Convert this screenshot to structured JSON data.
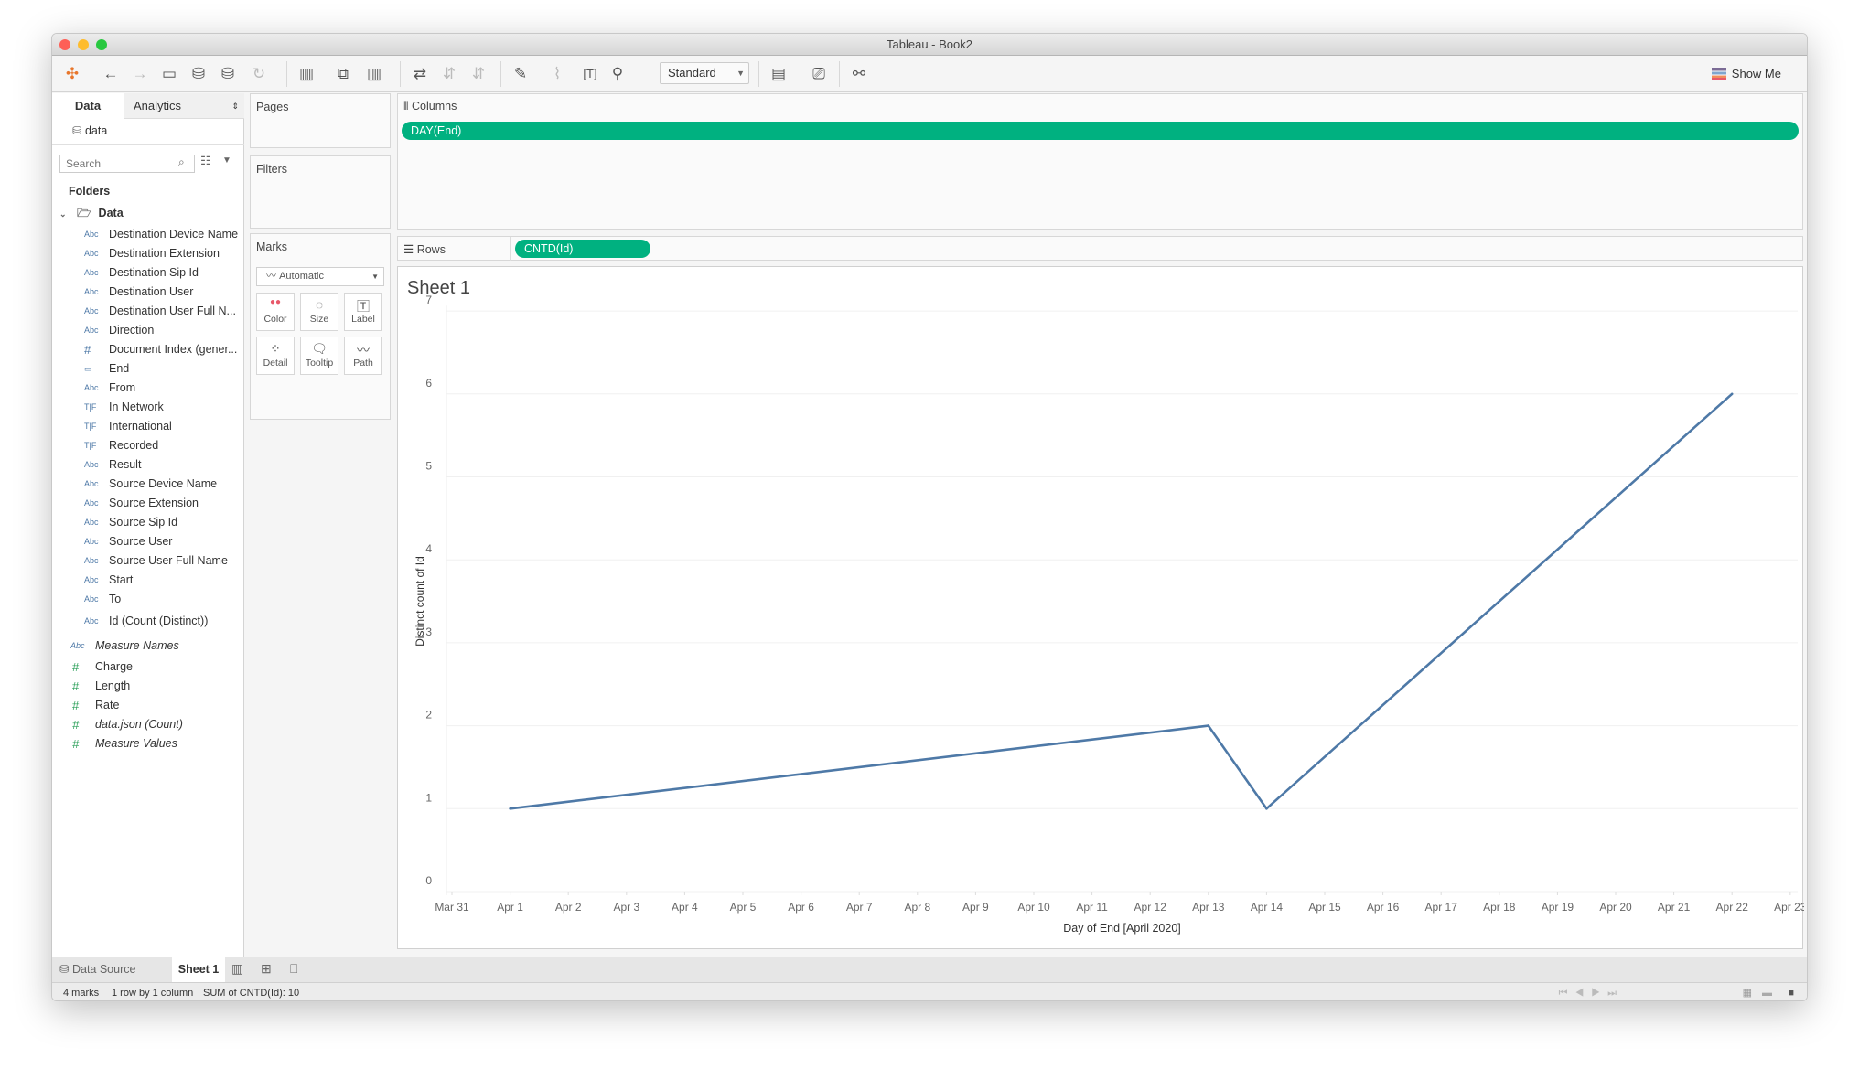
{
  "window": {
    "title": "Tableau - Book2"
  },
  "toolbar": {
    "mark_size_select": "Standard",
    "show_me": "Show Me"
  },
  "left_panel": {
    "tabs": [
      "Data",
      "Analytics"
    ],
    "datasource": "data",
    "search_placeholder": "Search",
    "folders_label": "Folders",
    "folder": "Data",
    "dimensions": [
      {
        "type": "Abc",
        "name": "Destination Device Name"
      },
      {
        "type": "Abc",
        "name": "Destination Extension"
      },
      {
        "type": "Abc",
        "name": "Destination Sip Id"
      },
      {
        "type": "Abc",
        "name": "Destination User"
      },
      {
        "type": "Abc",
        "name": "Destination User Full N..."
      },
      {
        "type": "Abc",
        "name": "Direction"
      },
      {
        "type": "#",
        "name": "Document Index (gener..."
      },
      {
        "type": "▭",
        "name": "End"
      },
      {
        "type": "Abc",
        "name": "From"
      },
      {
        "type": "T|F",
        "name": "In Network"
      },
      {
        "type": "T|F",
        "name": "International"
      },
      {
        "type": "T|F",
        "name": "Recorded"
      },
      {
        "type": "Abc",
        "name": "Result"
      },
      {
        "type": "Abc",
        "name": "Source Device Name"
      },
      {
        "type": "Abc",
        "name": "Source Extension"
      },
      {
        "type": "Abc",
        "name": "Source Sip Id"
      },
      {
        "type": "Abc",
        "name": "Source User"
      },
      {
        "type": "Abc",
        "name": "Source User Full Name"
      },
      {
        "type": "Abc",
        "name": "Start"
      },
      {
        "type": "Abc",
        "name": "To"
      },
      {
        "type": "Abc",
        "name": "Id (Count (Distinct))"
      }
    ],
    "measure_names": "Measure Names",
    "measures": [
      "Charge",
      "Length",
      "Rate",
      "data.json (Count)",
      "Measure Values"
    ]
  },
  "cards": {
    "pages": "Pages",
    "filters": "Filters",
    "marks": "Marks",
    "mark_type": "Automatic",
    "mark_buttons": [
      "Color",
      "Size",
      "Label",
      "Detail",
      "Tooltip",
      "Path"
    ]
  },
  "shelves": {
    "columns_label": "Columns",
    "columns_pill": "DAY(End)",
    "rows_label": "Rows",
    "rows_pill": "CNTD(Id)"
  },
  "sheet_title": "Sheet 1",
  "chart_data": {
    "type": "line",
    "title": "Sheet 1",
    "xlabel": "Day of End [April 2020]",
    "ylabel": "Distinct count of Id",
    "x_ticks": [
      "Mar 31",
      "Apr 1",
      "Apr 2",
      "Apr 3",
      "Apr 4",
      "Apr 5",
      "Apr 6",
      "Apr 7",
      "Apr 8",
      "Apr 9",
      "Apr 10",
      "Apr 11",
      "Apr 12",
      "Apr 13",
      "Apr 14",
      "Apr 15",
      "Apr 16",
      "Apr 17",
      "Apr 18",
      "Apr 19",
      "Apr 20",
      "Apr 21",
      "Apr 22",
      "Apr 23"
    ],
    "y_ticks": [
      0,
      1,
      2,
      3,
      4,
      5,
      6,
      7
    ],
    "ylim": [
      0,
      7
    ],
    "series": [
      {
        "name": "CNTD(Id)",
        "color": "#4e79a7",
        "points": [
          {
            "x": "Apr 1",
            "y": 1
          },
          {
            "x": "Apr 13",
            "y": 2
          },
          {
            "x": "Apr 14",
            "y": 1
          },
          {
            "x": "Apr 22",
            "y": 6
          }
        ]
      }
    ],
    "grid": true
  },
  "tabs": {
    "data_source": "Data Source",
    "sheet": "Sheet 1"
  },
  "status": {
    "marks": "4 marks",
    "dims": "1 row by 1 column",
    "sum": "SUM of CNTD(Id): 10"
  },
  "colors": {
    "pill": "#00b180",
    "line": "#4e79a7"
  }
}
